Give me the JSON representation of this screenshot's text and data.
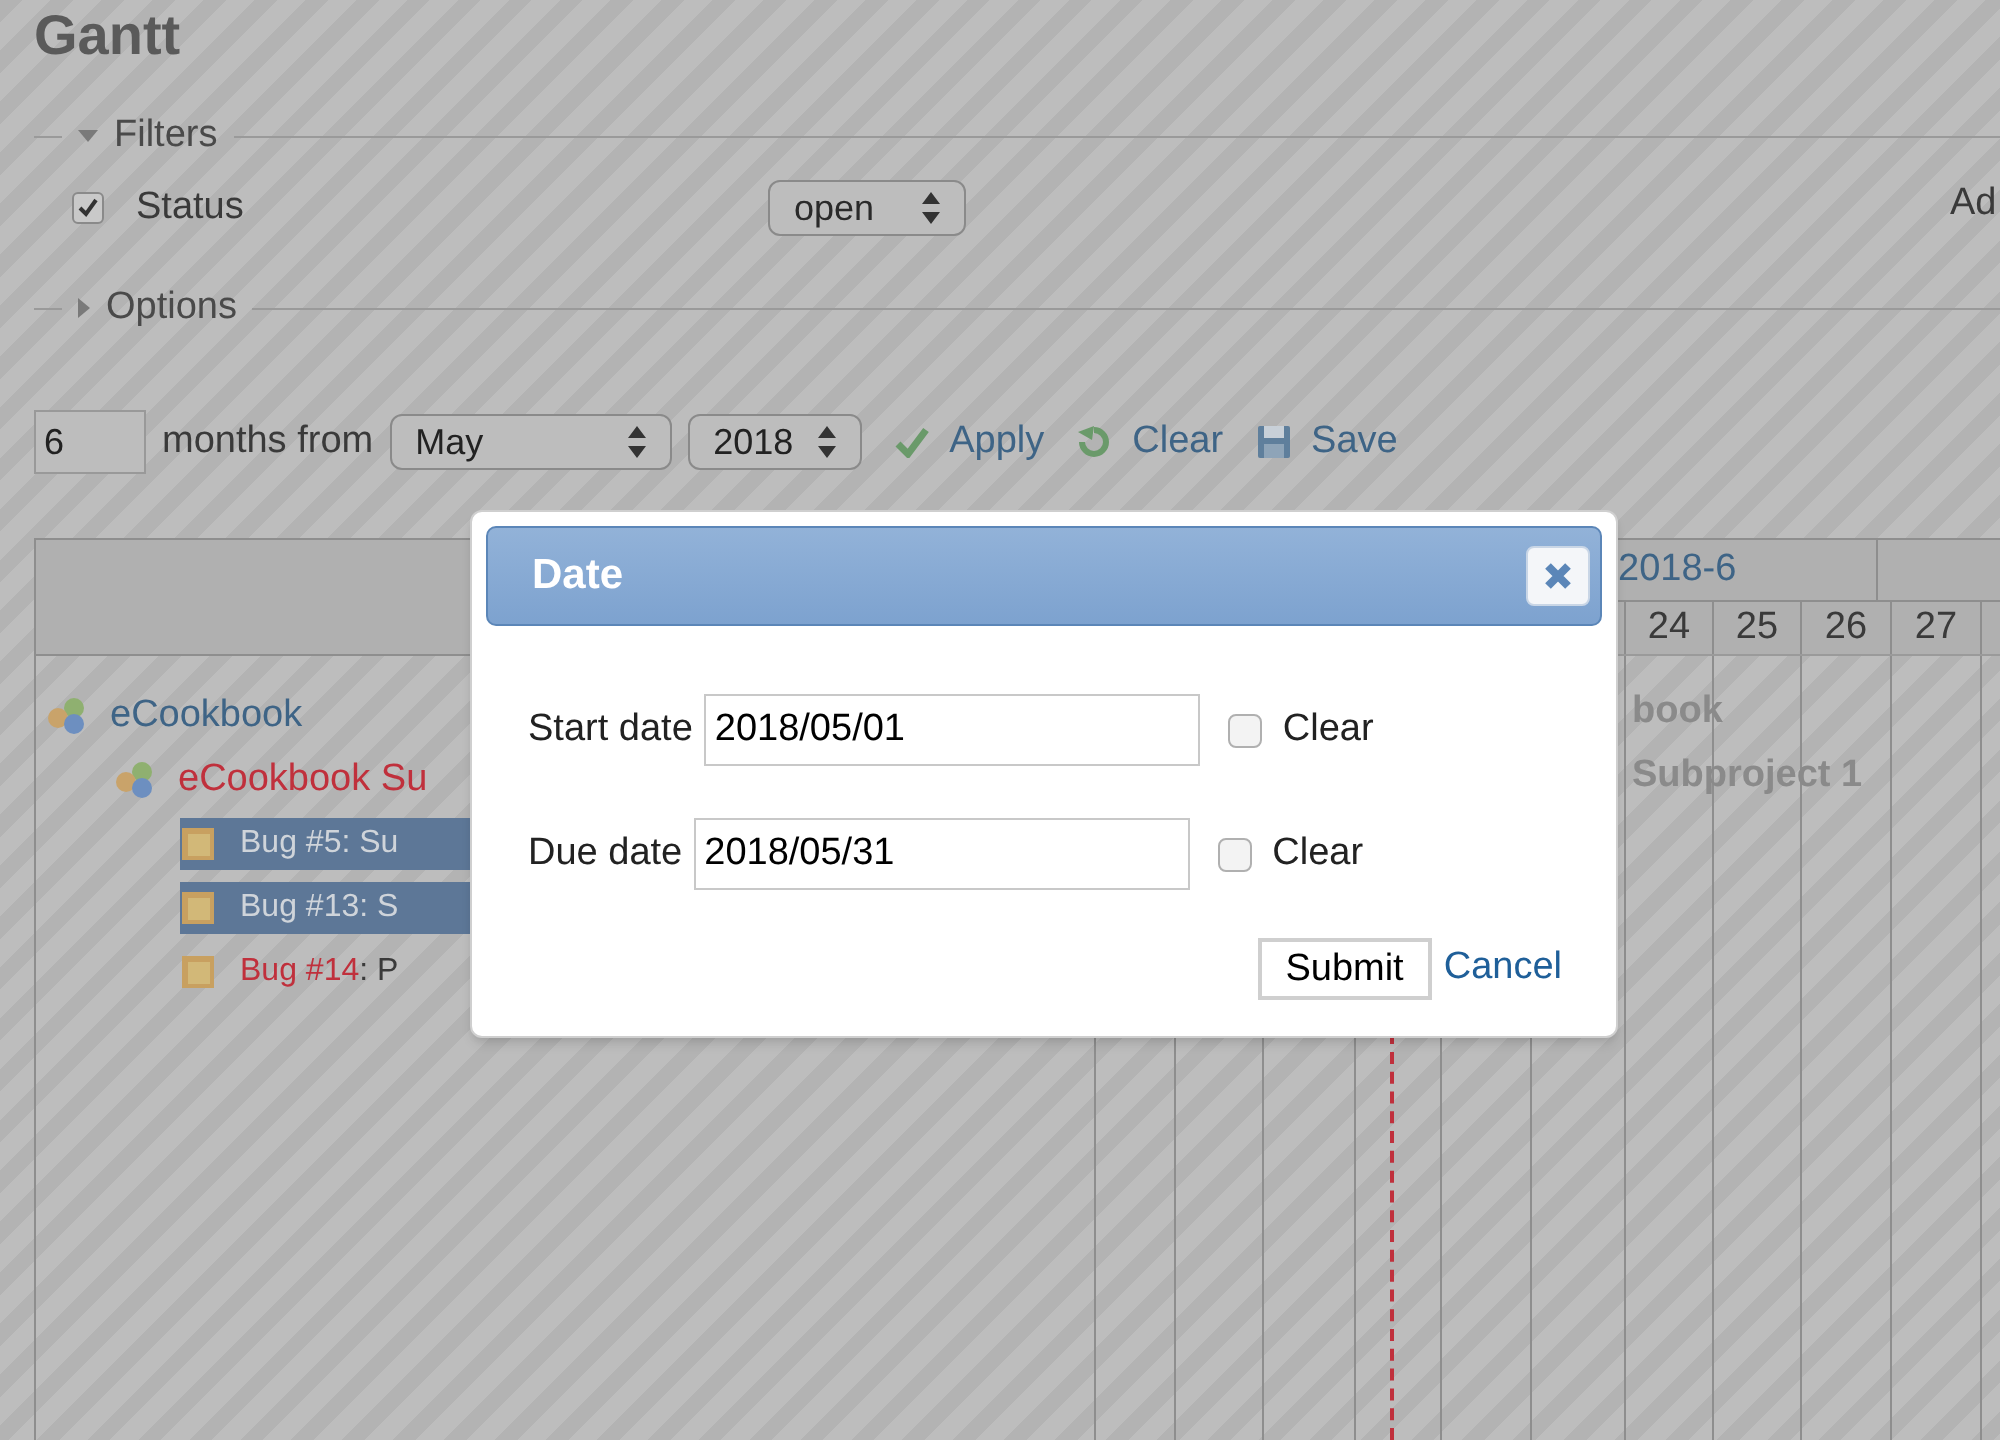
{
  "page": {
    "title": "Gantt"
  },
  "filters": {
    "legend": "Filters",
    "expanded": true,
    "rows": [
      {
        "label": "Status",
        "checked": true,
        "operator": "open"
      }
    ],
    "side_text": "Ad"
  },
  "options": {
    "legend": "Options",
    "expanded": false
  },
  "period": {
    "months": "6",
    "label": "months from",
    "month": "May",
    "year": "2018",
    "actions": [
      {
        "kind": "apply",
        "label": "Apply"
      },
      {
        "kind": "clear",
        "label": "Clear"
      },
      {
        "kind": "save",
        "label": "Save"
      }
    ]
  },
  "gantt": {
    "month_header": "2018-6",
    "days": [
      "24",
      "25",
      "26",
      "27"
    ],
    "subjects": [
      {
        "kind": "project",
        "name": "eCookbook",
        "selected": false,
        "children": [
          {
            "kind": "subproject",
            "name": "eCookbook Su",
            "selected": false,
            "children": [
              {
                "kind": "issue",
                "id": "Bug #5",
                "subject": ": Su",
                "selected": true
              },
              {
                "kind": "issue",
                "id": "Bug #13",
                "subject": ": S",
                "selected": true
              },
              {
                "kind": "issue",
                "id": "Bug #14",
                "subject": ": P",
                "selected": false
              }
            ]
          }
        ]
      }
    ],
    "bar_labels": [
      "book",
      "Subproject 1"
    ]
  },
  "dialog": {
    "title": "Date",
    "fields": [
      {
        "label": "Start date",
        "value": "2018/05/01",
        "clear_label": "Clear",
        "clear_checked": false
      },
      {
        "label": "Due date",
        "value": "2018/05/31",
        "clear_label": "Clear",
        "clear_checked": false
      }
    ],
    "submit": "Submit",
    "cancel": "Cancel"
  }
}
